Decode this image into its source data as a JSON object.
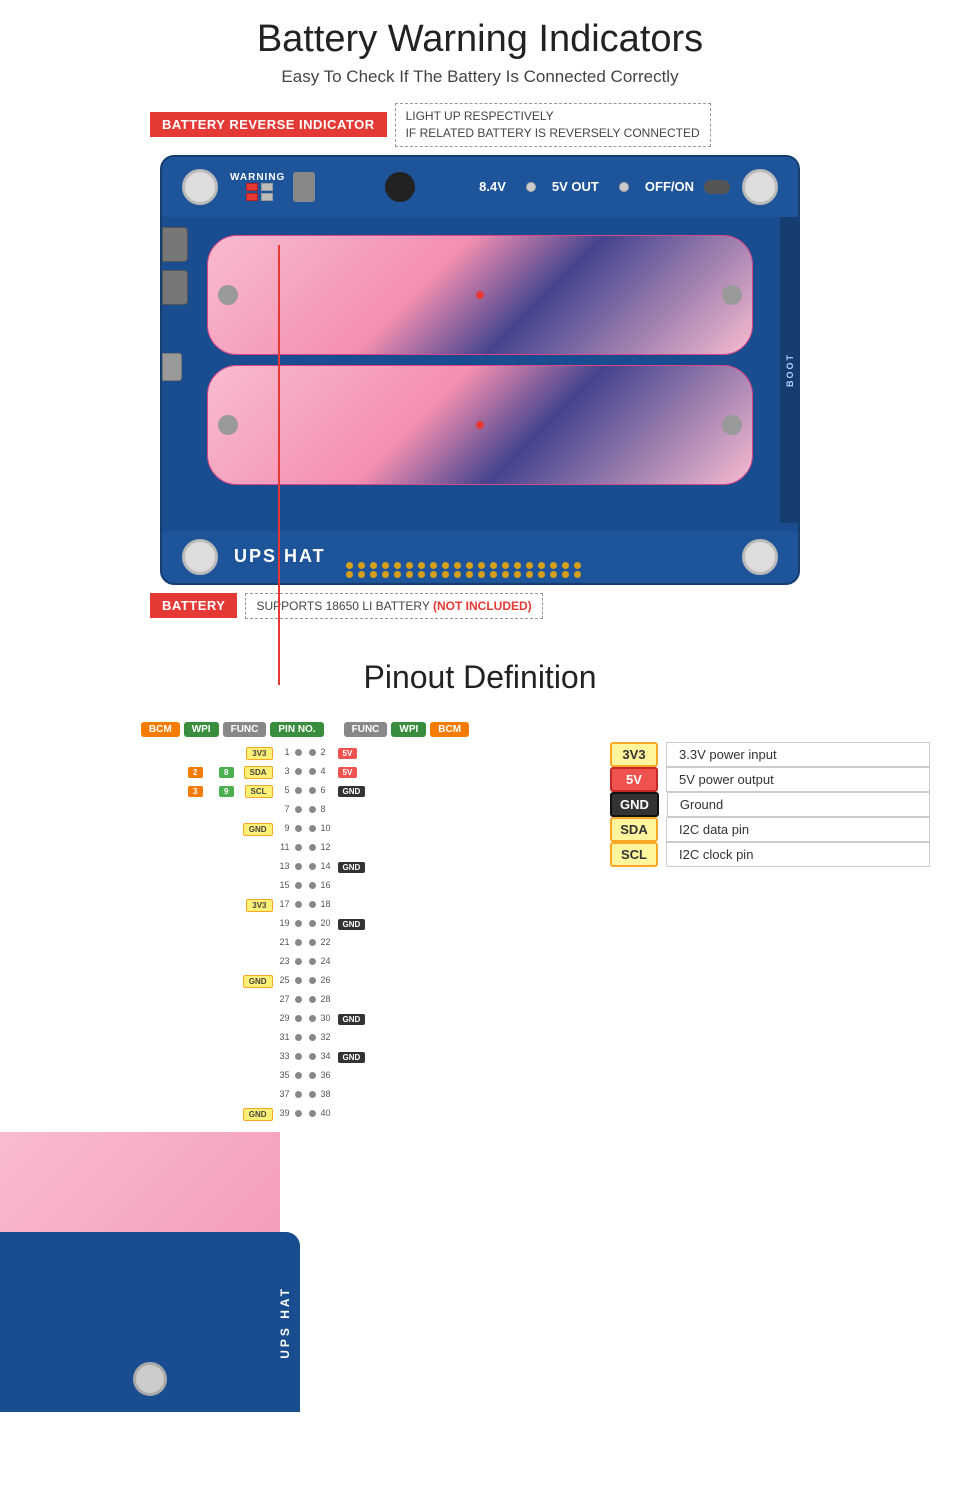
{
  "header": {
    "title": "Battery Warning Indicators",
    "subtitle": "Easy To Check If The Battery Is Connected Correctly"
  },
  "battery_section": {
    "indicator_badge": "BATTERY REVERSE INDICATOR",
    "indicator_desc_line1": "LIGHT UP RESPECTIVELY",
    "indicator_desc_line2": "IF RELATED BATTERY IS REVERSELY CONNECTED",
    "battery_badge": "BATTERY",
    "battery_desc_part1": "SUPPORTS 18650 LI BATTERY",
    "battery_desc_part2": "(NOT INCLUDED)",
    "board_labels": {
      "warning": "WARNING",
      "voltage": "8.4V",
      "five_v_out": "5V OUT",
      "off_on": "OFF/ON",
      "ups_hat": "UPS HAT",
      "boost": "BOOT"
    }
  },
  "pinout_section": {
    "title": "Pinout Definition",
    "legend": [
      {
        "badge": "3V3",
        "badge_class": "l3v3",
        "desc": "3.3V power input"
      },
      {
        "badge": "5V",
        "badge_class": "l5v",
        "desc": "5V power output"
      },
      {
        "badge": "GND",
        "badge_class": "lgnd",
        "desc": "Ground"
      },
      {
        "badge": "SDA",
        "badge_class": "lsda",
        "desc": "I2C data pin"
      },
      {
        "badge": "SCL",
        "badge_class": "lscl",
        "desc": "I2C clock pin"
      }
    ],
    "pin_headers": {
      "bcm": "BCM",
      "wpi": "WPI",
      "func_left": "FUNC",
      "pin_no": "PIN NO.",
      "func_right": "FUNC",
      "wpi_right": "WPI",
      "bcm_right": "BCM"
    },
    "pins": [
      {
        "bcm_l": "",
        "wpi_l": "",
        "func_l": "3V3",
        "func_l_class": "b-yellow",
        "pin_l": "1",
        "pin_r": "2",
        "func_r": "5V",
        "func_r_class": "b-red",
        "wpi_r": "",
        "bcm_r": ""
      },
      {
        "bcm_l": "2",
        "wpi_l": "8",
        "func_l": "SDA",
        "func_l_class": "b-yellow",
        "pin_l": "3",
        "pin_r": "4",
        "func_r": "5V",
        "func_r_class": "b-red",
        "wpi_r": "",
        "bcm_r": ""
      },
      {
        "bcm_l": "3",
        "wpi_l": "9",
        "func_l": "SCL",
        "func_l_class": "b-yellow",
        "pin_l": "5",
        "pin_r": "6",
        "func_r": "GND",
        "func_r_class": "b-dark",
        "wpi_r": "",
        "bcm_r": ""
      },
      {
        "bcm_l": "",
        "wpi_l": "",
        "func_l": "",
        "func_l_class": "",
        "pin_l": "7",
        "pin_r": "8",
        "func_r": "",
        "func_r_class": "",
        "wpi_r": "",
        "bcm_r": ""
      },
      {
        "bcm_l": "",
        "wpi_l": "",
        "func_l": "GND",
        "func_l_class": "b-yellow",
        "pin_l": "9",
        "pin_r": "10",
        "func_r": "",
        "func_r_class": "",
        "wpi_r": "",
        "bcm_r": ""
      },
      {
        "bcm_l": "",
        "wpi_l": "",
        "func_l": "",
        "func_l_class": "",
        "pin_l": "11",
        "pin_r": "12",
        "func_r": "",
        "func_r_class": "",
        "wpi_r": "",
        "bcm_r": ""
      },
      {
        "bcm_l": "",
        "wpi_l": "",
        "func_l": "",
        "func_l_class": "",
        "pin_l": "13",
        "pin_r": "14",
        "func_r": "GND",
        "func_r_class": "b-dark",
        "wpi_r": "",
        "bcm_r": ""
      },
      {
        "bcm_l": "",
        "wpi_l": "",
        "func_l": "",
        "func_l_class": "",
        "pin_l": "15",
        "pin_r": "16",
        "func_r": "",
        "func_r_class": "",
        "wpi_r": "",
        "bcm_r": ""
      },
      {
        "bcm_l": "",
        "wpi_l": "",
        "func_l": "3V3",
        "func_l_class": "b-yellow",
        "pin_l": "17",
        "pin_r": "18",
        "func_r": "",
        "func_r_class": "",
        "wpi_r": "",
        "bcm_r": ""
      },
      {
        "bcm_l": "",
        "wpi_l": "",
        "func_l": "",
        "func_l_class": "",
        "pin_l": "19",
        "pin_r": "20",
        "func_r": "GND",
        "func_r_class": "b-dark",
        "wpi_r": "",
        "bcm_r": ""
      },
      {
        "bcm_l": "",
        "wpi_l": "",
        "func_l": "",
        "func_l_class": "",
        "pin_l": "21",
        "pin_r": "22",
        "func_r": "",
        "func_r_class": "",
        "wpi_r": "",
        "bcm_r": ""
      },
      {
        "bcm_l": "",
        "wpi_l": "",
        "func_l": "",
        "func_l_class": "",
        "pin_l": "23",
        "pin_r": "24",
        "func_r": "",
        "func_r_class": "",
        "wpi_r": "",
        "bcm_r": ""
      },
      {
        "bcm_l": "",
        "wpi_l": "",
        "func_l": "GND",
        "func_l_class": "b-yellow",
        "pin_l": "25",
        "pin_r": "26",
        "func_r": "",
        "func_r_class": "",
        "wpi_r": "",
        "bcm_r": ""
      },
      {
        "bcm_l": "",
        "wpi_l": "",
        "func_l": "",
        "func_l_class": "",
        "pin_l": "27",
        "pin_r": "28",
        "func_r": "",
        "func_r_class": "",
        "wpi_r": "",
        "bcm_r": ""
      },
      {
        "bcm_l": "",
        "wpi_l": "",
        "func_l": "",
        "func_l_class": "",
        "pin_l": "29",
        "pin_r": "30",
        "func_r": "GND",
        "func_r_class": "b-dark",
        "wpi_r": "",
        "bcm_r": ""
      },
      {
        "bcm_l": "",
        "wpi_l": "",
        "func_l": "",
        "func_l_class": "",
        "pin_l": "31",
        "pin_r": "32",
        "func_r": "",
        "func_r_class": "",
        "wpi_r": "",
        "bcm_r": ""
      },
      {
        "bcm_l": "",
        "wpi_l": "",
        "func_l": "",
        "func_l_class": "",
        "pin_l": "33",
        "pin_r": "34",
        "func_r": "GND",
        "func_r_class": "b-dark",
        "wpi_r": "",
        "bcm_r": ""
      },
      {
        "bcm_l": "",
        "wpi_l": "",
        "func_l": "",
        "func_l_class": "",
        "pin_l": "35",
        "pin_r": "36",
        "func_r": "",
        "func_r_class": "",
        "wpi_r": "",
        "bcm_r": ""
      },
      {
        "bcm_l": "",
        "wpi_l": "",
        "func_l": "",
        "func_l_class": "",
        "pin_l": "37",
        "pin_r": "38",
        "func_r": "",
        "func_r_class": "",
        "wpi_r": "",
        "bcm_r": ""
      },
      {
        "bcm_l": "",
        "wpi_l": "",
        "func_l": "GND",
        "func_l_class": "b-yellow",
        "pin_l": "39",
        "pin_r": "40",
        "func_r": "",
        "func_r_class": "",
        "wpi_r": "",
        "bcm_r": ""
      }
    ]
  },
  "colors": {
    "red": "#e53935",
    "board_blue": "#1a4d8f",
    "battery_pink": "#f8bbd0"
  }
}
